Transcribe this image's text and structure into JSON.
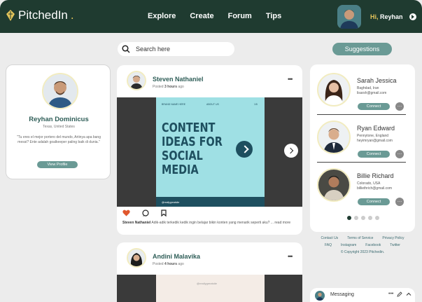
{
  "nav": {
    "logo_text": "PitchedIn",
    "logo_dot": ".",
    "links": [
      "Explore",
      "Create",
      "Forum",
      "Tips"
    ],
    "greeting_hi": "Hi,",
    "greeting_name": "Reyhan"
  },
  "search": {
    "placeholder": "Search here"
  },
  "suggestions_button": "Suggestions",
  "profile": {
    "name": "Reyhan Dominicus",
    "location": "Texas, United States",
    "quote": "\"Tu eres el mejor portero del mundo, Artinya apa bang messi? Ente adalah goalkeeper paling baik di dunia.\"",
    "view_button": "View Profile"
  },
  "post1": {
    "author": "Steven Nathaniel",
    "time_prefix": "Posted",
    "time_value": "3 hours",
    "time_suffix": "ago",
    "menu": "•••",
    "slide": {
      "top_left": "BRAND NAME HERE",
      "top_mid": "ABOUT US",
      "top_right": "1/5",
      "title": "CONTENT IDEAS FOR SOCIAL MEDIA",
      "handle": "@reallygreatsite"
    },
    "caption_author": "Steven Nathaniel",
    "caption_text": " Adik-adik terkedik kedik ingin belajar bikin konten yang menarik seperti aku?",
    "read_more": "... read more"
  },
  "post2": {
    "author": "Andini Malavika",
    "time_prefix": "Posted",
    "time_value": "4 hours",
    "time_suffix": "ago",
    "menu": "•••",
    "slide_handle": "@reallygreatsite"
  },
  "suggestions": [
    {
      "name": "Sarah Jessica",
      "city": "Baghdad, Iran",
      "email": "lisarsh@gmail.com",
      "connect": "Connect"
    },
    {
      "name": "Ryan Edward",
      "city": "Pennytone, England",
      "email": "heyimryan@gmail.com",
      "connect": "Connect"
    },
    {
      "name": "Billie Richard",
      "city": "Colorado, USA",
      "email": "billiethrich@gmail.com",
      "connect": "Connect"
    }
  ],
  "footer": {
    "row1": [
      "Contact Us",
      "Terms of Service",
      "Privacy Policy"
    ],
    "row2": [
      "FAQ",
      "Instagram",
      "Facebook",
      "Twitter"
    ],
    "copyright": "© Copyright 2023 Pitchedin."
  },
  "messaging": {
    "label": "Messaging",
    "icons": "•••"
  },
  "colors": {
    "nav": "#1f3b30",
    "accent": "#6a9a95",
    "gold": "#e4c45a",
    "teal_text": "#2f5e58"
  }
}
